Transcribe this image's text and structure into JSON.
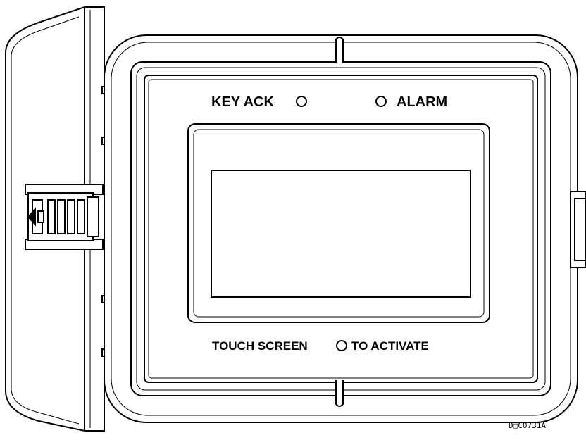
{
  "device": {
    "labels": {
      "key_ack": "KEY ACK",
      "alarm": "ALARM",
      "touch_screen": "TOUCH SCREEN",
      "to_activate": "TO ACTIVATE"
    },
    "document_id": "D□C0731A"
  },
  "colors": {
    "line": "#000000",
    "background": "#ffffff",
    "led_ring": "#000000"
  },
  "icons": {
    "indicator": "indicator-led-icon",
    "latch": "latch-icon",
    "hinge": "hinge-icon"
  }
}
